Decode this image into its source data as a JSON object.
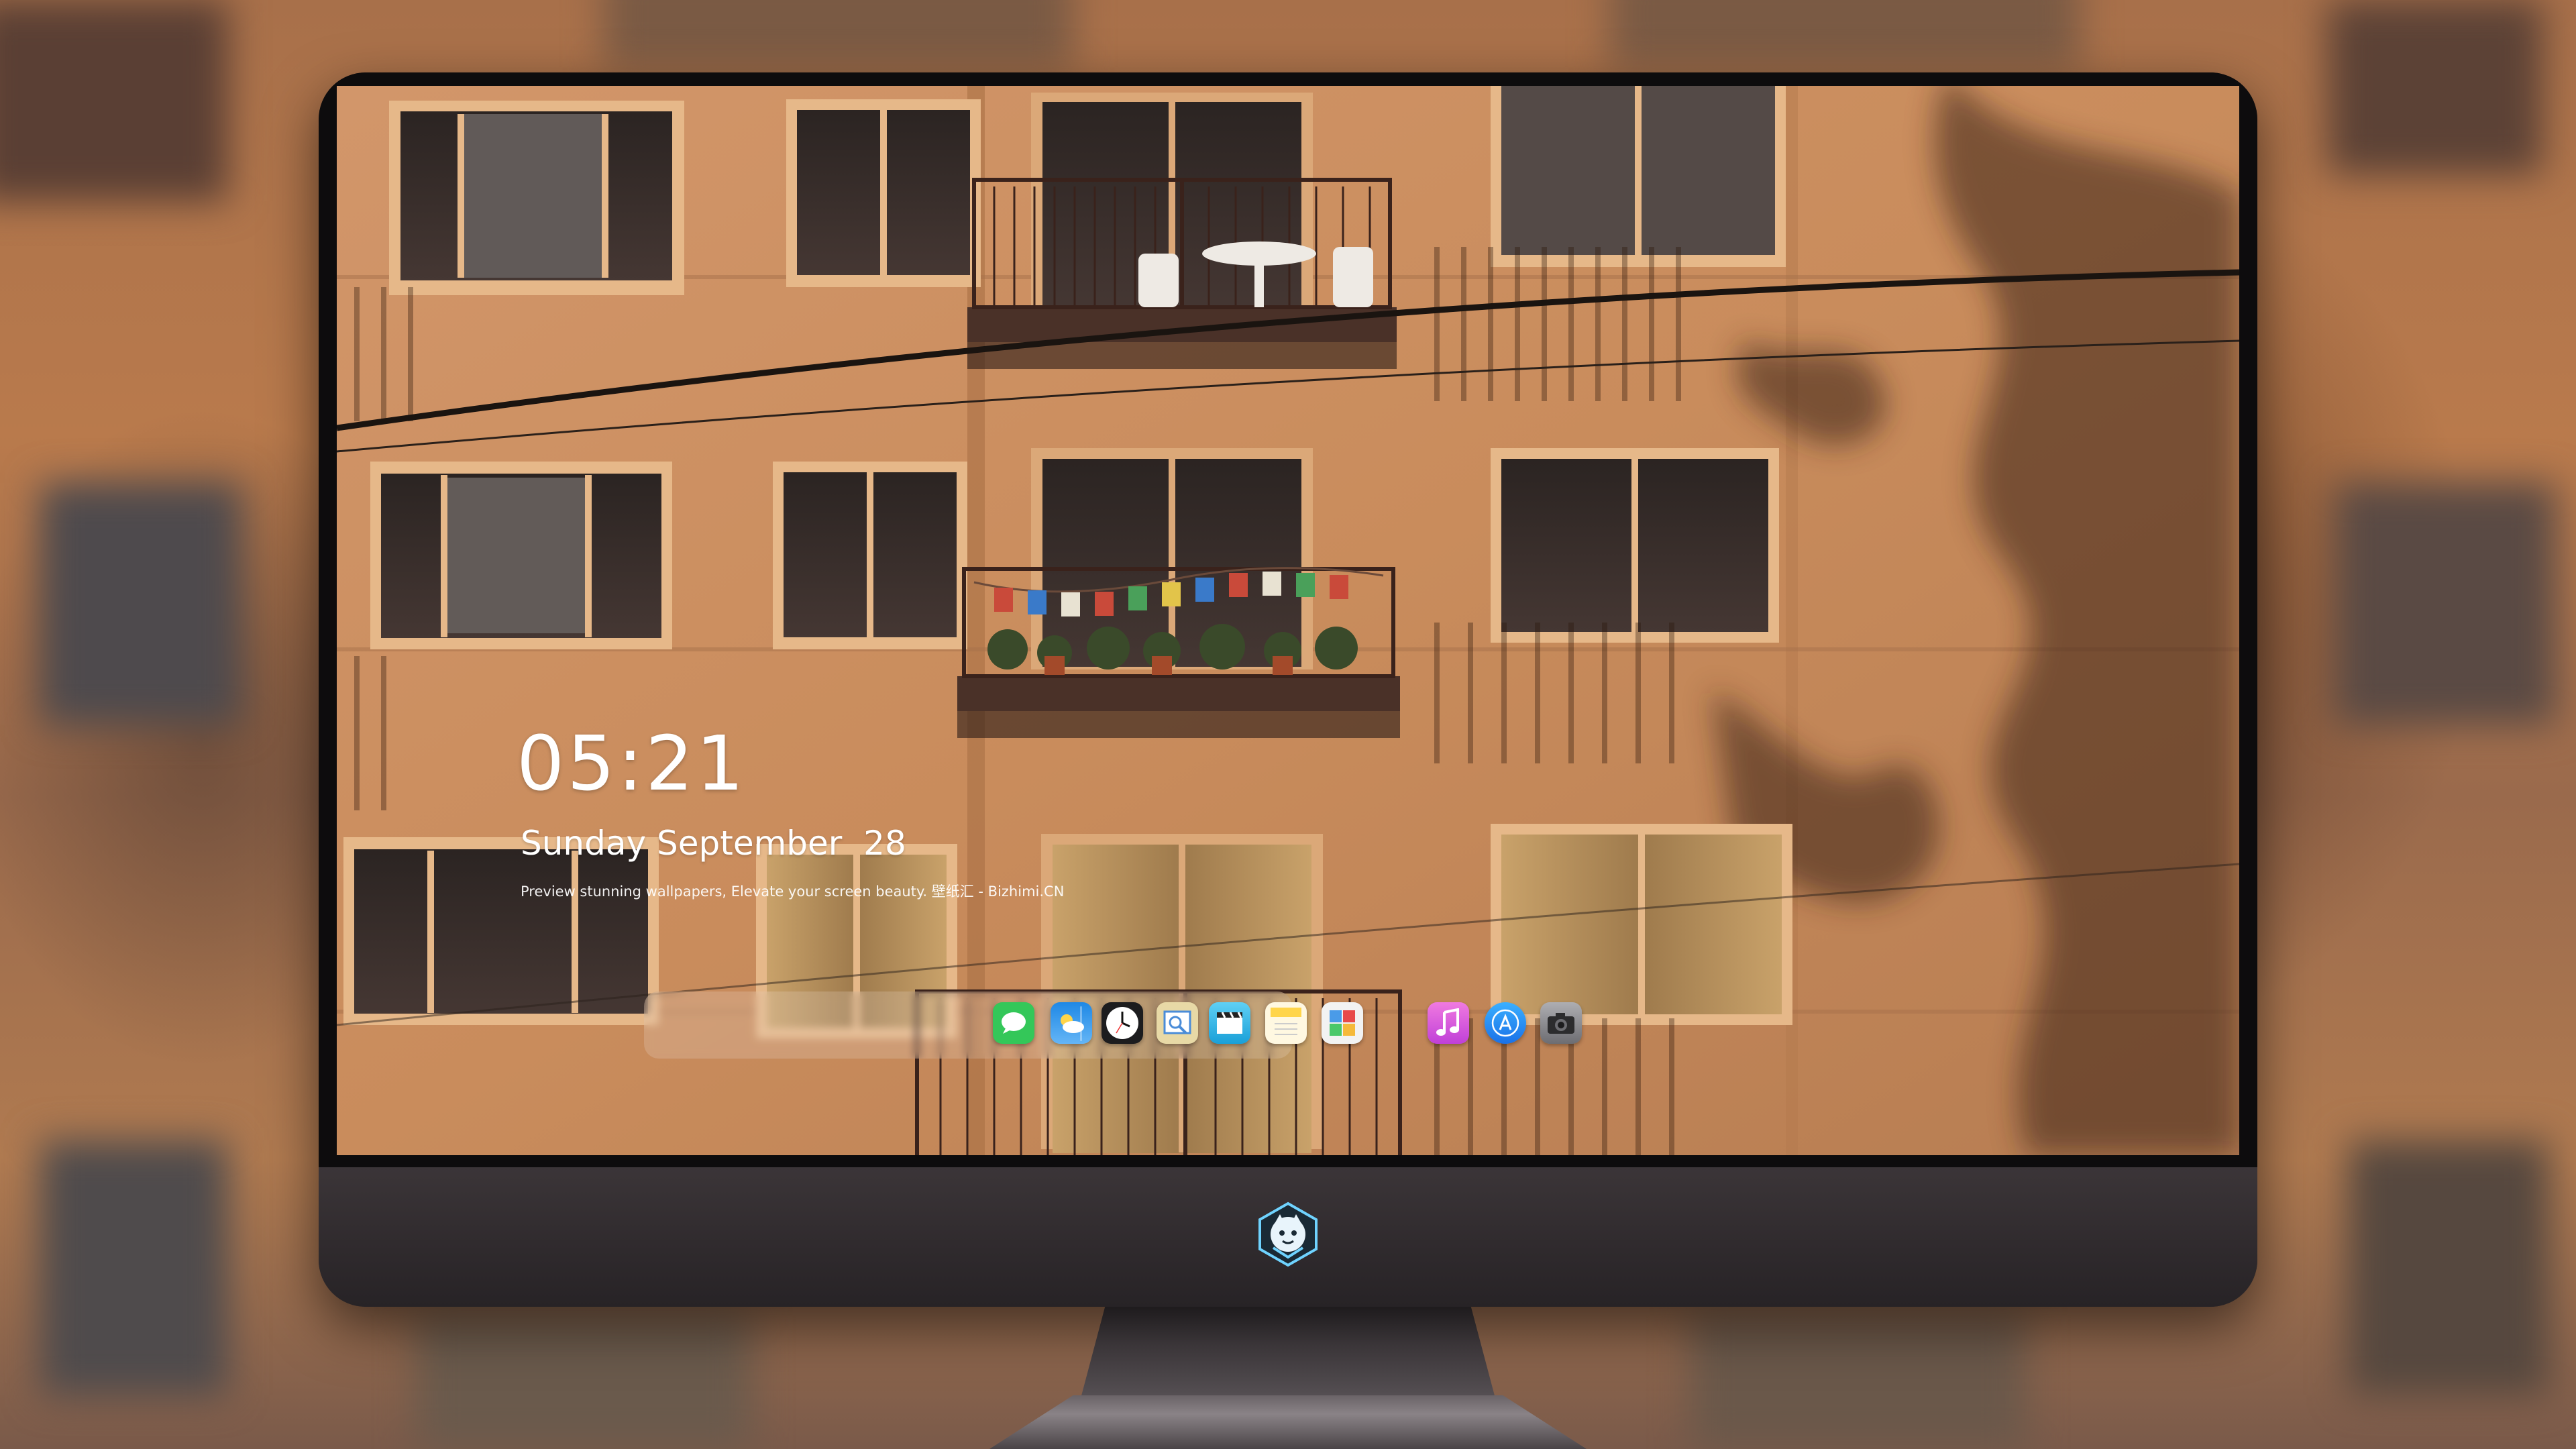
{
  "lock_screen": {
    "time": "05:21",
    "date": "Sunday September  28",
    "tagline": "Preview stunning wallpapers, Elevate your screen beauty. 壁纸汇 - Bizhimi.CN"
  },
  "dock": {
    "apps": [
      {
        "name": "messages-icon",
        "color": "#34c759"
      },
      {
        "name": "weather-icon",
        "color": "#1e88e5"
      },
      {
        "name": "clock-icon",
        "color": "#1c1c1e"
      },
      {
        "name": "preview-icon",
        "color": "#e8d9a6"
      },
      {
        "name": "clips-icon",
        "color": "#3fb6e8"
      },
      {
        "name": "notes-icon",
        "color": "#ffd54a"
      },
      {
        "name": "photo-booth-icon",
        "color": "#f2f2f2"
      },
      {
        "name": "music-icon",
        "color": "#e14fd6"
      },
      {
        "name": "app-store-icon",
        "color": "#1e88e5"
      },
      {
        "name": "camera-icon",
        "color": "#8e8e93"
      }
    ]
  },
  "monitor": {
    "logo": "mascot-logo-icon"
  }
}
